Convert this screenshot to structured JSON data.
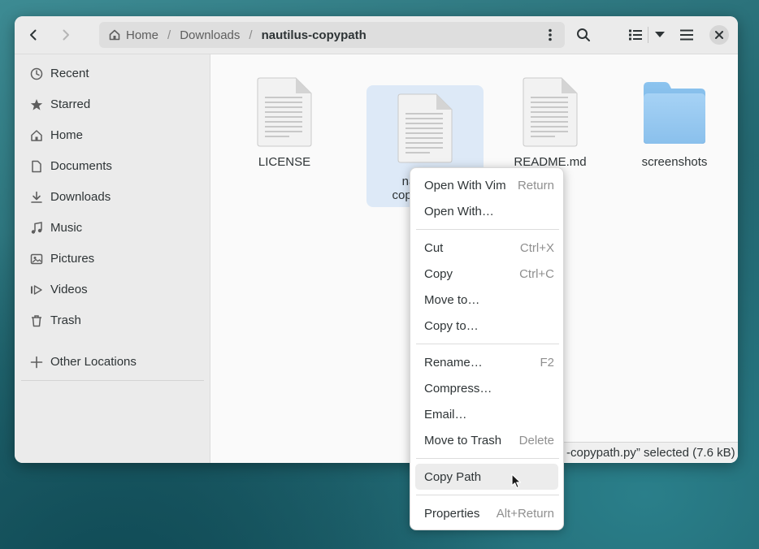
{
  "toolbar": {
    "back_icon": "chevron-left-icon",
    "forward_icon": "chevron-right-icon",
    "search_icon": "search-icon",
    "view_icon": "list-view-icon",
    "menu_icon": "hamburger-icon",
    "close_icon": "close-icon"
  },
  "pathbar": {
    "home": "Home",
    "sep1": "/",
    "downloads": "Downloads",
    "sep2": "/",
    "current": "nautilus-copypath"
  },
  "sidebar": {
    "items": [
      {
        "label": "Recent",
        "icon": "clock-icon"
      },
      {
        "label": "Starred",
        "icon": "star-icon"
      },
      {
        "label": "Home",
        "icon": "home-icon"
      },
      {
        "label": "Documents",
        "icon": "document-icon"
      },
      {
        "label": "Downloads",
        "icon": "download-icon"
      },
      {
        "label": "Music",
        "icon": "music-icon"
      },
      {
        "label": "Pictures",
        "icon": "picture-icon"
      },
      {
        "label": "Videos",
        "icon": "video-icon"
      },
      {
        "label": "Trash",
        "icon": "trash-icon"
      }
    ],
    "other_locations": "Other Locations"
  },
  "files": [
    {
      "name": "LICENSE",
      "type": "text"
    },
    {
      "name": "nautilus-copypath.py",
      "name_line1": "nautilus-",
      "name_line2": "copypath.py",
      "type": "text",
      "selected": true
    },
    {
      "name": "README.md",
      "type": "text"
    },
    {
      "name": "screenshots",
      "type": "folder"
    }
  ],
  "status": {
    "text": "-copypath.py” selected  (7.6 kB)"
  },
  "context_menu": {
    "items": [
      {
        "label": "Open With Vim",
        "accel": "Return"
      },
      {
        "label": "Open With…",
        "accel": ""
      },
      {
        "label": "Cut",
        "accel": "Ctrl+X"
      },
      {
        "label": "Copy",
        "accel": "Ctrl+C"
      },
      {
        "label": "Move to…",
        "accel": ""
      },
      {
        "label": "Copy to…",
        "accel": ""
      },
      {
        "label": "Rename…",
        "accel": "F2"
      },
      {
        "label": "Compress…",
        "accel": ""
      },
      {
        "label": "Email…",
        "accel": ""
      },
      {
        "label": "Move to Trash",
        "accel": "Delete"
      },
      {
        "label": "Copy Path",
        "accel": "",
        "hovered": true
      },
      {
        "label": "Properties",
        "accel": "Alt+Return"
      }
    ]
  },
  "colors": {
    "selection": "#dde9f7",
    "folder": "#7fb8e6",
    "sidebar_bg": "#ebebeb"
  }
}
